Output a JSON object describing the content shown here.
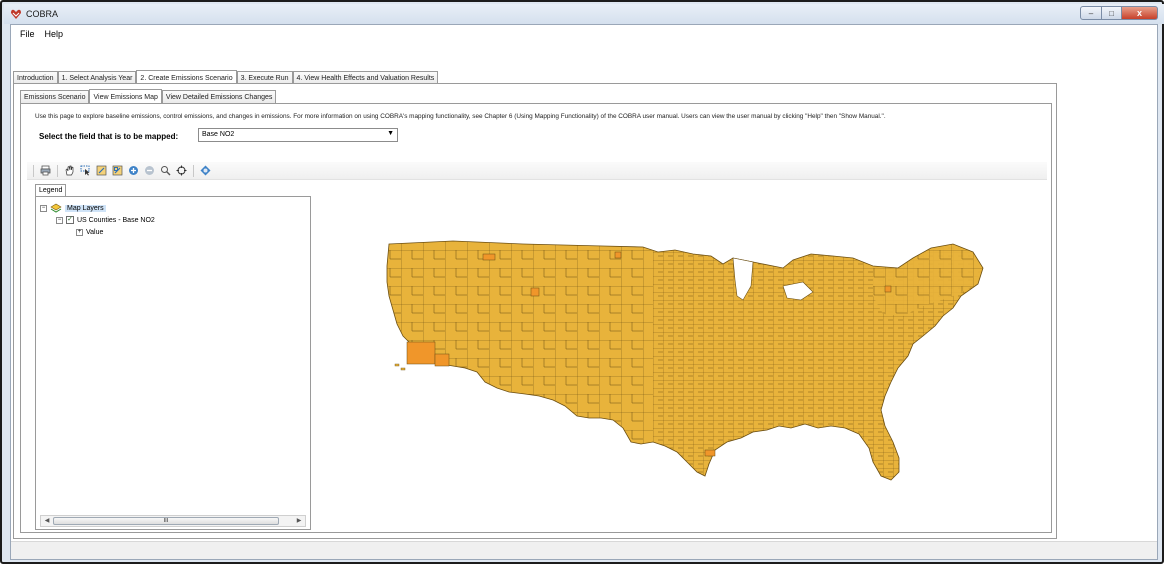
{
  "window": {
    "title": "COBRA",
    "buttons": {
      "minimize": "–",
      "maximize": "□",
      "close": "x"
    }
  },
  "menubar": {
    "items": [
      "File",
      "Help"
    ]
  },
  "main_tabs": [
    "Introduction",
    "1. Select Analysis Year",
    "2. Create Emissions Scenario",
    "3. Execute Run",
    "4. View Health Effects and Valuation Results"
  ],
  "active_main_tab": 2,
  "sub_tabs": [
    "Emissions Scenario",
    "View Emissions Map",
    "View Detailed Emissions Changes"
  ],
  "active_sub_tab": 1,
  "page": {
    "description": "Use this page to explore baseline emissions, control emissions, and changes in emissions.  For more information on using COBRA's mapping functionality, see Chapter 6 (Using Mapping Functionality) of the COBRA user manual.  Users can view the user manual by clicking \"Help\" then \"Show Manual.\".",
    "field_label": "Select the field that is to be mapped:",
    "field_value": "Base NO2"
  },
  "toolbar": {
    "icons": [
      "print-icon",
      "pan-hand-icon",
      "select-icon",
      "zoom-in-box-icon",
      "zoom-out-box-icon",
      "zoom-in-icon",
      "zoom-out-icon",
      "identify-icon",
      "full-extent-icon",
      "globe-icon"
    ]
  },
  "legend": {
    "tab_label": "Legend",
    "root": "Map Layers",
    "layer": "US Counties - Base NO2",
    "field": "Value",
    "scroll_label": "III"
  },
  "colors": {
    "map_fill": "#e8b33b",
    "map_fill_high": "#f0962a",
    "map_border": "#6b4e12"
  }
}
